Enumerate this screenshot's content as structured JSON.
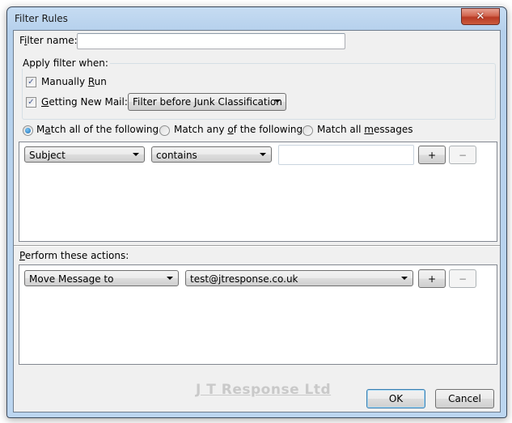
{
  "window": {
    "title": "Filter Rules",
    "close_icon": "close-x-icon"
  },
  "filter_name": {
    "label_pre": "F",
    "label_mn": "i",
    "label_post": "lter name:",
    "value": ""
  },
  "apply_when": {
    "legend": "Apply filter when:",
    "manually_run": {
      "pre": "Manually ",
      "mn": "R",
      "post": "un",
      "checked": true
    },
    "getting_new_mail": {
      "pre": "",
      "mn": "G",
      "post": "etting New Mail:",
      "checked": true
    },
    "timing_select": {
      "value": "Filter before Junk Classification"
    }
  },
  "match": {
    "options": [
      {
        "pre": "M",
        "mn": "a",
        "post": "tch all of the following",
        "selected": true
      },
      {
        "pre": "Match any ",
        "mn": "o",
        "post": "f the following",
        "selected": false
      },
      {
        "pre": "Match all ",
        "mn": "m",
        "post": "essages",
        "selected": false
      }
    ]
  },
  "rules": [
    {
      "field": "Subject",
      "operator": "contains",
      "value": "",
      "add_label": "+",
      "remove_label": "−",
      "remove_enabled": false
    }
  ],
  "actions": {
    "label_mn": "P",
    "label_post": "erform these actions:",
    "rows": [
      {
        "action": "Move Message to",
        "target": "test@jtresponse.co.uk",
        "add_label": "+",
        "remove_label": "−",
        "remove_enabled": false
      }
    ]
  },
  "footer": {
    "brand": "J T Response Ltd",
    "ok_label": "OK",
    "cancel_label": "Cancel"
  },
  "colors": {
    "title_glass": "#bcd6f0",
    "close_red": "#c9452f",
    "dialog_bg": "#f0f0f0",
    "radio_selected": "#1a6cb4"
  }
}
